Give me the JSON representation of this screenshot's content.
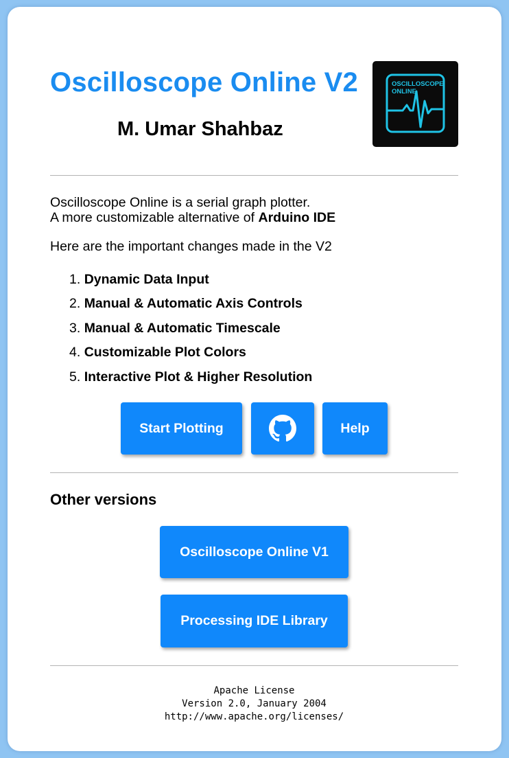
{
  "header": {
    "title": "Oscilloscope Online V2",
    "author": "M. Umar Shahbaz",
    "logo": {
      "text_line1": "OSCILLOSCOPE",
      "text_line2": "ONLINE",
      "accent_color": "#1fc3e6",
      "background_color": "#0b0b0b"
    }
  },
  "intro": {
    "line1": "Oscilloscope Online is a serial graph plotter.",
    "line2_prefix": "A more customizable alternative of ",
    "line2_bold": "Arduino IDE",
    "changes_intro": "Here are the important changes made in the V2"
  },
  "changes": [
    {
      "num": "1.",
      "text": "Dynamic Data Input"
    },
    {
      "num": "2.",
      "text": "Manual & Automatic Axis Controls"
    },
    {
      "num": "3.",
      "text": "Manual & Automatic Timescale"
    },
    {
      "num": "4.",
      "text": "Customizable Plot Colors"
    },
    {
      "num": "5.",
      "text": "Interactive Plot & Higher Resolution"
    }
  ],
  "actions": {
    "start_label": "Start Plotting",
    "github_icon": "github-icon",
    "help_label": "Help"
  },
  "other_versions": {
    "heading": "Other versions",
    "v1_label": "Oscilloscope Online V1",
    "processing_label": "Processing IDE Library"
  },
  "license": {
    "line1": "Apache License",
    "line2": "Version 2.0, January 2004",
    "line3": "http://www.apache.org/licenses/"
  },
  "colors": {
    "page_background": "#8fc4f2",
    "title": "#1a8cf0",
    "button": "#1088fb"
  }
}
